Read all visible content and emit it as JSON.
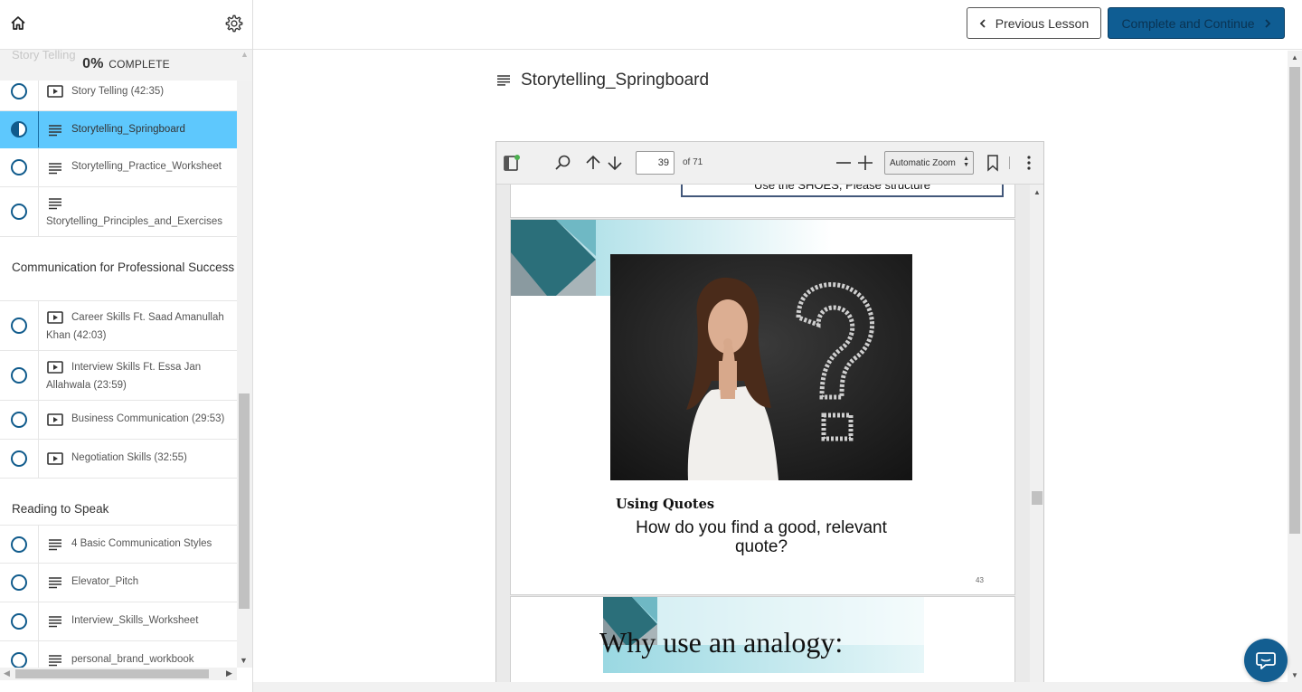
{
  "sidebar": {
    "ghost_section": "Story Telling",
    "progress": {
      "percent": "0%",
      "label": "COMPLETE",
      "value": 0
    },
    "group1": [
      {
        "title": "Story Telling (42:35)",
        "icon": "video-icon",
        "status": "not-started"
      },
      {
        "title": "Storytelling_Springboard",
        "icon": "text-icon",
        "status": "in-progress",
        "active": true
      },
      {
        "title": "Storytelling_Practice_Worksheet",
        "icon": "text-icon",
        "status": "not-started"
      },
      {
        "title": "Storytelling_Principles_and_Exercises",
        "icon": "text-icon",
        "status": "not-started"
      }
    ],
    "section2": {
      "title": "Communication for Professional Success",
      "lessons": [
        {
          "title": "Career Skills Ft. Saad Amanullah Khan (42:03)",
          "icon": "video-icon"
        },
        {
          "title": "Interview Skills Ft. Essa Jan Allahwala (23:59)",
          "icon": "video-icon"
        },
        {
          "title": "Business Communication (29:53)",
          "icon": "video-icon"
        },
        {
          "title": "Negotiation Skills (32:55)",
          "icon": "video-icon"
        }
      ]
    },
    "section3": {
      "title": "Reading to Speak",
      "lessons": [
        {
          "title": "4 Basic Communication Styles",
          "icon": "text-icon"
        },
        {
          "title": "Elevator_Pitch",
          "icon": "text-icon"
        },
        {
          "title": "Interview_Skills_Worksheet",
          "icon": "text-icon"
        },
        {
          "title": "personal_brand_workbook",
          "icon": "text-icon"
        }
      ]
    }
  },
  "topbar": {
    "prev_label": "Previous Lesson",
    "next_label": "Complete and Continue"
  },
  "main": {
    "title": "Storytelling_Springboard"
  },
  "pdf": {
    "page_input": "39",
    "page_of": "of 71",
    "zoom": "Automatic Zoom",
    "page_top_text": "Use the SHOES, Please structure",
    "slide_heading": "Using Quotes",
    "slide_question": "How do you find a good, relevant quote?",
    "slide_number": "43",
    "next_slide_heading": "Why use an analogy:"
  },
  "colors": {
    "primary": "#0f5d93",
    "active_lesson": "#5ec8fd",
    "circle": "#105b8c"
  }
}
